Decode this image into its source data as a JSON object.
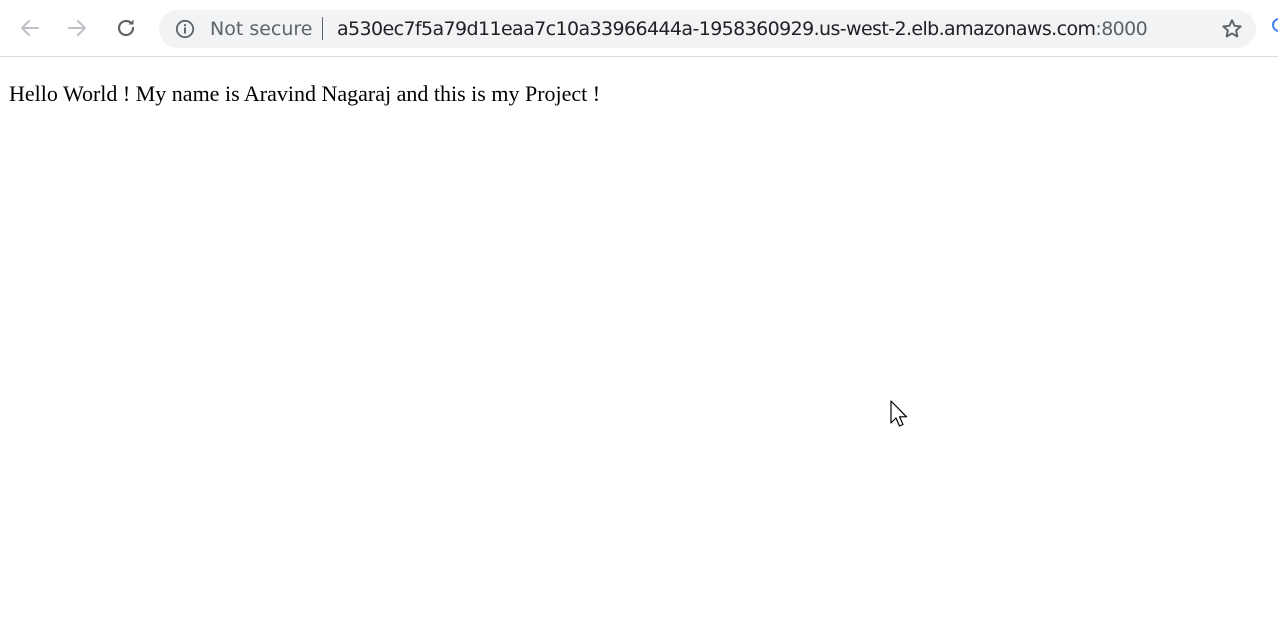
{
  "browser": {
    "security_label": "Not secure",
    "url_host": "a530ec7f5a79d11eaa7c10a33966444a-1958360929.us-west-2.elb.amazonaws.com",
    "url_port": ":8000",
    "icons": {
      "back": "arrow-left-icon",
      "forward": "arrow-right-icon",
      "reload": "reload-icon",
      "info": "info-icon",
      "bookmark": "star-icon"
    },
    "colors": {
      "icon": "#5f6368",
      "omnibox_bg": "#f1f3f4",
      "url_text": "#202124"
    }
  },
  "page": {
    "body_text": "Hello World ! My name is Aravind Nagaraj and this is my Project !"
  }
}
